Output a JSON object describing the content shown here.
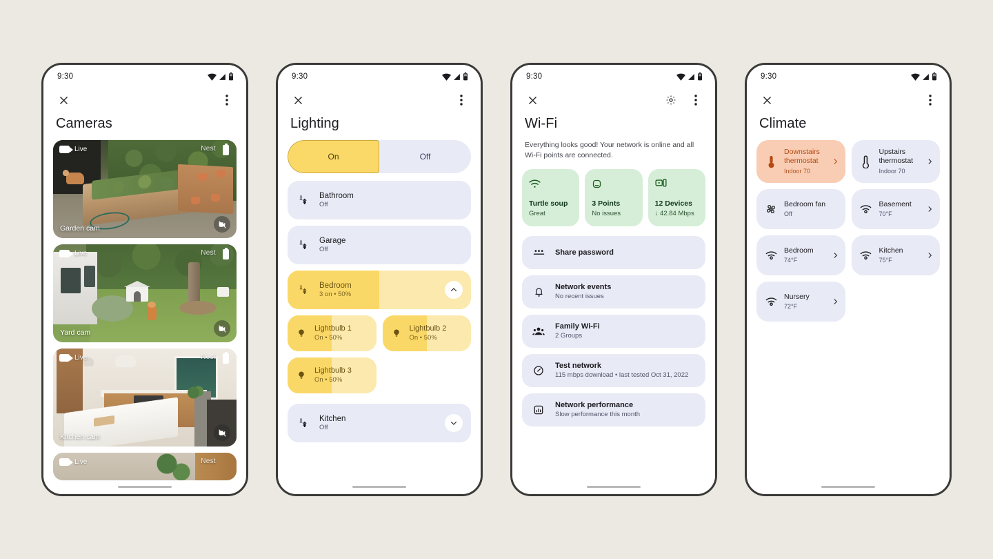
{
  "status_bar": {
    "time": "9:30",
    "icons": [
      "wifi-icon",
      "cell-signal-icon",
      "battery-icon"
    ]
  },
  "cameras": {
    "title": "Cameras",
    "close_label": "close-icon",
    "overflow_label": "more-options-icon",
    "tiles": [
      {
        "live_label": "Live",
        "brand": "Nest",
        "name": "Garden cam",
        "scene": "garden"
      },
      {
        "live_label": "Live",
        "brand": "Nest",
        "name": "Yard cam",
        "scene": "yard"
      },
      {
        "live_label": "Live",
        "brand": "Nest",
        "name": "Kitchen cam",
        "scene": "kitchen"
      },
      {
        "live_label": "Live",
        "brand": "Nest",
        "name": "",
        "scene": "plant"
      }
    ]
  },
  "lighting": {
    "title": "Lighting",
    "toggle": {
      "on_label": "On",
      "off_label": "Off",
      "selected": "On"
    },
    "rows": [
      {
        "name": "Bathroom",
        "status": "Off",
        "state": "off",
        "fill": 0,
        "expand": null
      },
      {
        "name": "Garage",
        "status": "Off",
        "state": "off",
        "fill": 0,
        "expand": null
      },
      {
        "name": "Bedroom",
        "status": "3 on • 50%",
        "state": "on",
        "fill": 50,
        "expand": "collapse-chevron-icon"
      }
    ],
    "bulbs": [
      {
        "name": "Lightbulb 1",
        "status": "On • 50%",
        "fill": 50
      },
      {
        "name": "Lightbulb 2",
        "status": "On • 50%",
        "fill": 50
      },
      {
        "name": "Lightbulb 3",
        "status": "On • 50%",
        "fill": 50
      }
    ],
    "footer_row": {
      "name": "Kitchen",
      "status": "Off",
      "state": "off",
      "fill": 0,
      "expand": "expand-chevron-icon"
    }
  },
  "wifi": {
    "title": "Wi-Fi",
    "settings_label": "gear-icon",
    "description": "Everything looks good! Your network is online and all Wi-Fi points are connected.",
    "cards": [
      {
        "icon": "wifi-icon",
        "title": "Turtle soup",
        "subtitle": "Great"
      },
      {
        "icon": "router-icon",
        "title": "3 Points",
        "subtitle": "No issues"
      },
      {
        "icon": "devices-icon",
        "title": "12 Devices",
        "subtitle": "↓ 42.84 Mbps"
      }
    ],
    "rows": [
      {
        "icon": "password-dots-icon",
        "title": "Share password",
        "subtitle": ""
      },
      {
        "icon": "bell-icon",
        "title": "Network events",
        "subtitle": "No recent issues"
      },
      {
        "icon": "family-group-icon",
        "title": "Family Wi-Fi",
        "subtitle": "2 Groups"
      },
      {
        "icon": "speedometer-icon",
        "title": "Test network",
        "subtitle": "115 mbps download • last tested Oct 31, 2022"
      },
      {
        "icon": "bar-chart-icon",
        "title": "Network performance",
        "subtitle": "Slow performance this month"
      }
    ]
  },
  "climate": {
    "title": "Climate",
    "cards": [
      {
        "icon": "thermostat-filled-icon",
        "title": "Downstairs thermostat",
        "subtitle": "Indoor 70",
        "active": true,
        "chevron": true
      },
      {
        "icon": "thermostat-outline-icon",
        "title": "Upstairs thermostat",
        "subtitle": "Indoor 70",
        "active": false,
        "chevron": true
      },
      {
        "icon": "fan-icon",
        "title": "Bedroom fan",
        "subtitle": "Off",
        "active": false,
        "chevron": false
      },
      {
        "icon": "sensor-icon",
        "title": "Basement",
        "subtitle": "70°F",
        "active": false,
        "chevron": true
      },
      {
        "icon": "sensor-icon",
        "title": "Bedroom",
        "subtitle": "74°F",
        "active": false,
        "chevron": true
      },
      {
        "icon": "sensor-icon",
        "title": "Kitchen",
        "subtitle": "75°F",
        "active": false,
        "chevron": true
      },
      {
        "icon": "sensor-icon",
        "title": "Nursery",
        "subtitle": "72°F",
        "active": false,
        "chevron": true
      }
    ]
  },
  "colors": {
    "page_background": "#ECE9E3",
    "surface_blue": "#E8EAF6",
    "accent_yellow": "#FAD867",
    "accent_yellow_light": "#FCE9AE",
    "accent_green": "#D6EED7",
    "accent_peach": "#F8CDB4",
    "text_primary": "#1C1B1F",
    "text_secondary": "#51546A"
  }
}
